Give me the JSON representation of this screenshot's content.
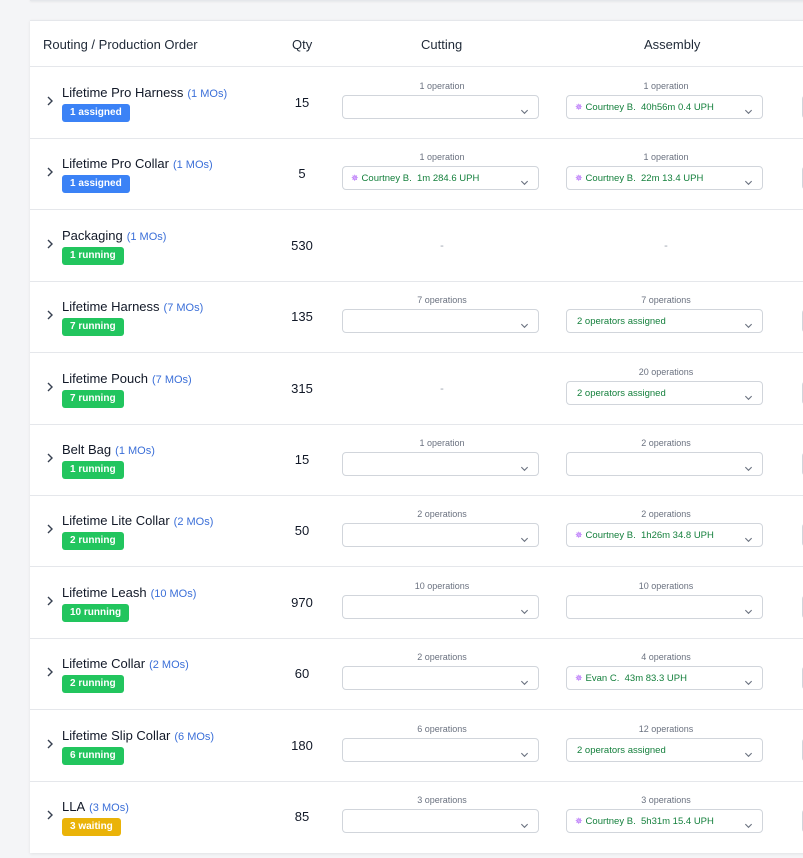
{
  "columns": {
    "routing": "Routing / Production Order",
    "qty": "Qty",
    "cutting": "Cutting",
    "assembly": "Assembly"
  },
  "rows": [
    {
      "name": "Lifetime Pro Harness",
      "mos": "(1 MOs)",
      "badge": "1 assigned",
      "badge_color": "#3b82f6",
      "qty": "15",
      "cutting": {
        "ops": "1 operation",
        "value": ""
      },
      "assembly": {
        "ops": "1 operation",
        "operator": "Courtney B.",
        "value": "40h56m 0.4 UPH"
      }
    },
    {
      "name": "Lifetime Pro Collar",
      "mos": "(1 MOs)",
      "badge": "1 assigned",
      "badge_color": "#3b82f6",
      "qty": "5",
      "cutting": {
        "ops": "1 operation",
        "operator": "Courtney B.",
        "value": "1m 284.6 UPH"
      },
      "assembly": {
        "ops": "1 operation",
        "operator": "Courtney B.",
        "value": "22m 13.4 UPH"
      }
    },
    {
      "name": "Packaging",
      "mos": "(1 MOs)",
      "badge": "1 running",
      "badge_color": "#22c55e",
      "qty": "530",
      "cutting": {
        "dash": "-"
      },
      "assembly": {
        "dash": "-"
      }
    },
    {
      "name": "Lifetime Harness",
      "mos": "(7 MOs)",
      "badge": "7 running",
      "badge_color": "#22c55e",
      "qty": "135",
      "cutting": {
        "ops": "7 operations",
        "value": ""
      },
      "assembly": {
        "ops": "7 operations",
        "value": "2 operators assigned"
      }
    },
    {
      "name": "Lifetime Pouch",
      "mos": "(7 MOs)",
      "badge": "7 running",
      "badge_color": "#22c55e",
      "qty": "315",
      "cutting": {
        "dash": "-"
      },
      "assembly": {
        "ops": "20 operations",
        "value": "2 operators assigned"
      }
    },
    {
      "name": "Belt Bag",
      "mos": "(1 MOs)",
      "badge": "1 running",
      "badge_color": "#22c55e",
      "qty": "15",
      "cutting": {
        "ops": "1 operation",
        "value": ""
      },
      "assembly": {
        "ops": "2 operations",
        "value": ""
      }
    },
    {
      "name": "Lifetime Lite Collar",
      "mos": "(2 MOs)",
      "badge": "2 running",
      "badge_color": "#22c55e",
      "qty": "50",
      "cutting": {
        "ops": "2 operations",
        "value": ""
      },
      "assembly": {
        "ops": "2 operations",
        "operator": "Courtney B.",
        "value": "1h26m 34.8 UPH"
      }
    },
    {
      "name": "Lifetime Leash",
      "mos": "(10 MOs)",
      "badge": "10 running",
      "badge_color": "#22c55e",
      "qty": "970",
      "cutting": {
        "ops": "10 operations",
        "value": ""
      },
      "assembly": {
        "ops": "10 operations",
        "value": ""
      }
    },
    {
      "name": "Lifetime Collar",
      "mos": "(2 MOs)",
      "badge": "2 running",
      "badge_color": "#22c55e",
      "qty": "60",
      "cutting": {
        "ops": "2 operations",
        "value": ""
      },
      "assembly": {
        "ops": "4 operations",
        "operator": "Evan C.",
        "value": "43m 83.3 UPH"
      }
    },
    {
      "name": "Lifetime Slip Collar",
      "mos": "(6 MOs)",
      "badge": "6 running",
      "badge_color": "#22c55e",
      "qty": "180",
      "cutting": {
        "ops": "6 operations",
        "value": ""
      },
      "assembly": {
        "ops": "12 operations",
        "value": "2 operators assigned"
      }
    },
    {
      "name": "LLA",
      "mos": "(3 MOs)",
      "badge": "3 waiting",
      "badge_color": "#eab308",
      "qty": "85",
      "cutting": {
        "ops": "3 operations",
        "value": ""
      },
      "assembly": {
        "ops": "3 operations",
        "operator": "Courtney B.",
        "value": "5h31m 15.4 UPH"
      }
    }
  ]
}
